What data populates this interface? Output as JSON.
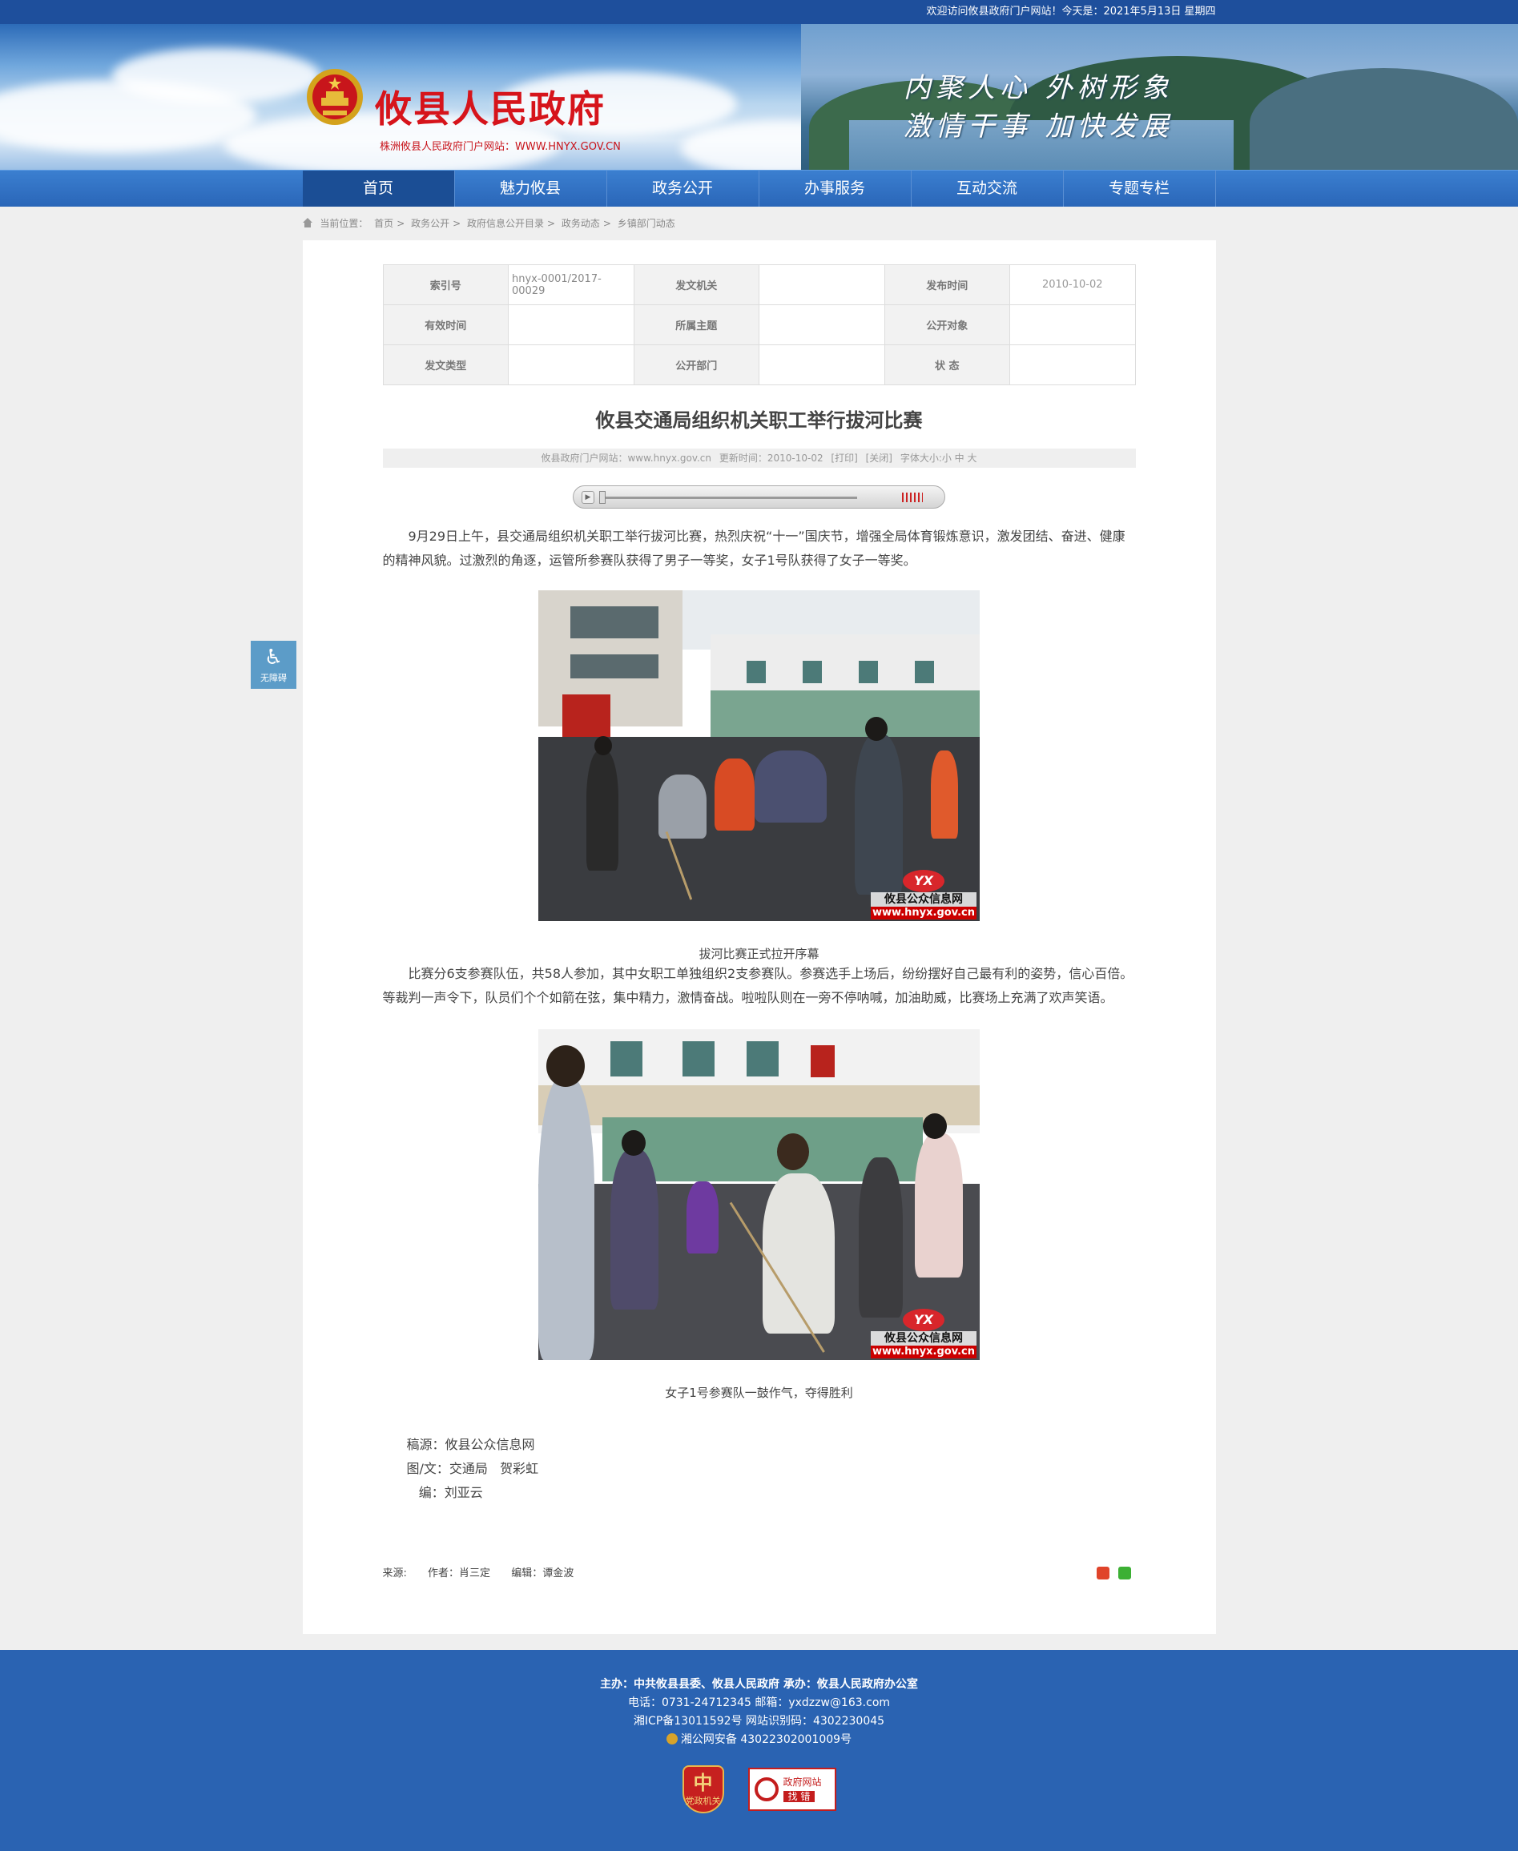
{
  "topbar": {
    "welcome": "欢迎访问攸县政府门户网站！今天是：2021年5月13日 星期四"
  },
  "banner": {
    "site_name": "攸县人民政府",
    "site_sub": "株洲攸县人民政府门户网站：WWW.HNYX.GOV.CN",
    "slogan_line1": "内聚人心  外树形象",
    "slogan_line2": "激情干事  加快发展"
  },
  "nav": {
    "items": [
      "首页",
      "魅力攸县",
      "政务公开",
      "办事服务",
      "互动交流",
      "专题专栏"
    ]
  },
  "breadcrumb": {
    "label": "当前位置：",
    "items": [
      "首页",
      "政务公开",
      "政府信息公开目录",
      "政务动态",
      "乡镇部门动态"
    ],
    "separator": ">"
  },
  "meta": {
    "rows": [
      [
        {
          "k": "索引号",
          "v": "hnyx-0001/2017-00029"
        },
        {
          "k": "发文机关",
          "v": ""
        },
        {
          "k": "发布时间",
          "v": "2010-10-02"
        }
      ],
      [
        {
          "k": "有效时间",
          "v": ""
        },
        {
          "k": "所属主题",
          "v": ""
        },
        {
          "k": "公开对象",
          "v": ""
        }
      ],
      [
        {
          "k": "发文类型",
          "v": ""
        },
        {
          "k": "公开部门",
          "v": ""
        },
        {
          "k": "状 态",
          "v": ""
        }
      ]
    ]
  },
  "article": {
    "title": "攸县交通局组织机关职工举行拔河比赛",
    "info": {
      "site": "攸县政府门户网站：www.hnyx.gov.cn",
      "updated": "更新时间：2010-10-02",
      "print": "[打印]",
      "close": "[关闭]",
      "font": "字体大小:小 中 大"
    },
    "para1": "9月29日上午，县交通局组织机关职工举行拔河比赛，热烈庆祝“十一”国庆节，增强全局体育锻炼意识，激发团结、奋进、健康的精神风貌。过激烈的角逐，运管所参赛队获得了男子一等奖，女子1号队获得了女子一等奖。",
    "caption1": "拔河比赛正式拉开序幕",
    "para2": "比赛分6支参赛队伍，共58人参加，其中女职工单独组织2支参赛队。参赛选手上场后，纷纷摆好自己最有利的姿势，信心百倍。等裁判一声令下，队员们个个如箭在弦，集中精力，激情奋战。啦啦队则在一旁不停呐喊，加油助威，比赛场上充满了欢声笑语。",
    "caption2": "女子1号参赛队一鼓作气，夺得胜利",
    "watermark": {
      "logo": "YX",
      "name": "攸县公众信息网",
      "url": "www.hnyx.gov.cn"
    },
    "credits": [
      "稿源：攸县公众信息网",
      "图/文：交通局   贺彩虹",
      "   编：刘亚云"
    ],
    "footer": {
      "source": "来源:",
      "author": "作者：肖三定",
      "editor": "编辑：谭金波"
    }
  },
  "accessibility": {
    "label": "无障碍"
  },
  "footer": {
    "line1": "主办：中共攸县县委、攸县人民政府  承办：攸县人民政府办公室",
    "line2": "电话：0731-24712345  邮箱：yxdzzw@163.com",
    "line3": "湘ICP备13011592号    网站识别码：4302230045",
    "line4": "湘公网安备 43022302001009号",
    "badge1_big": "中",
    "badge1_text": "党政机关",
    "badge2_line1": "政府网站",
    "badge2_line2": "找 错"
  },
  "colors": {
    "brand_blue": "#2a63b2",
    "topbar": "#1e4f9c",
    "title_red": "#d6141b"
  }
}
